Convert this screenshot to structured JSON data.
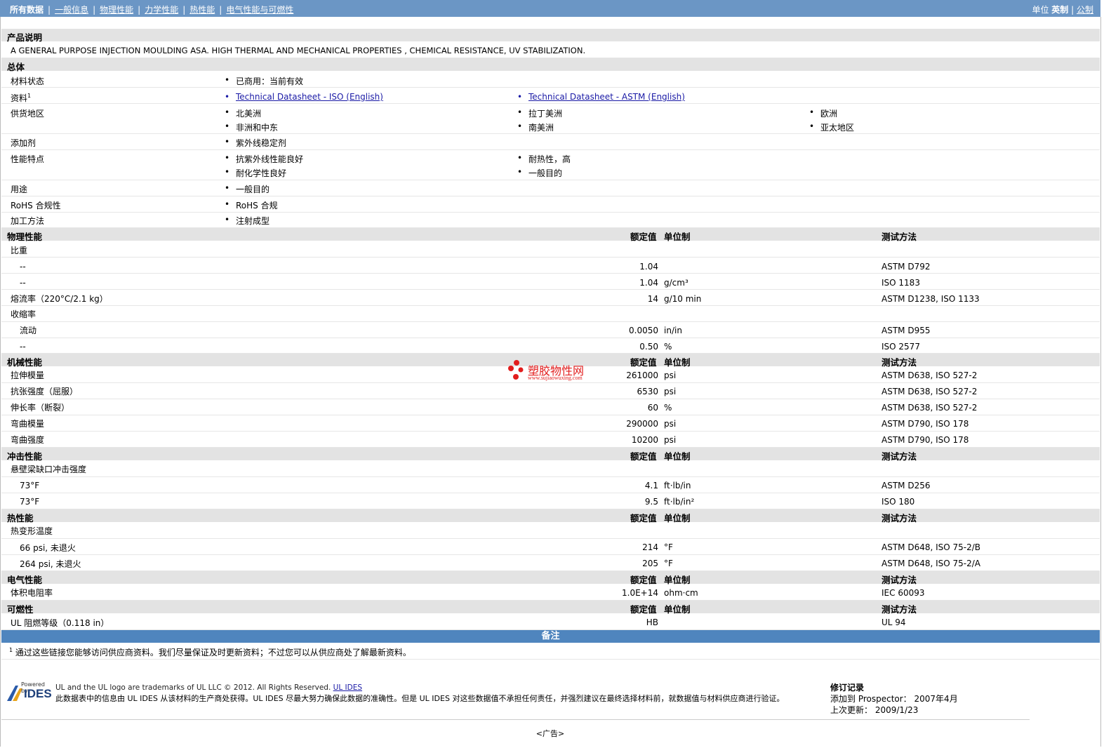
{
  "nav": {
    "items": [
      "所有数据",
      "一般信息",
      "物理性能",
      "力学性能",
      "热性能",
      "电气性能与可燃性"
    ],
    "units_label": "单位",
    "units_imperial": "英制",
    "units_metric": "公制"
  },
  "product": {
    "section_title": "产品说明",
    "description": "A GENERAL PURPOSE INJECTION MOULDING ASA. HIGH THERMAL AND MECHANICAL PROPERTIES , CHEMICAL RESISTANCE, UV STABILIZATION."
  },
  "general": {
    "section_title": "总体",
    "material_status_label": "材料状态",
    "material_status": "已商用：当前有效",
    "docs_label": "资料",
    "docs_sup": "1",
    "doc1": "Technical Datasheet - ISO (English)",
    "doc2": "Technical Datasheet - ASTM (English)",
    "regions_label": "供货地区",
    "regions": [
      "北美洲",
      "拉丁美洲",
      "欧洲",
      "非洲和中东",
      "南美洲",
      "亚太地区"
    ],
    "additives_label": "添加剂",
    "additives": "紫外线稳定剂",
    "features_label": "性能特点",
    "features": [
      "抗紫外线性能良好",
      "耐热性，高",
      "耐化学性良好",
      "一般目的"
    ],
    "uses_label": "用途",
    "uses": "一般目的",
    "rohs_label": "RoHS 合规性",
    "rohs": "RoHS 合规",
    "processing_label": "加工方法",
    "processing": "注射成型"
  },
  "headers": {
    "nominal": "额定值",
    "unit": "单位制",
    "test": "测试方法"
  },
  "physical": {
    "section_title": "物理性能",
    "rows": [
      {
        "label": "比重",
        "value": "",
        "unit": "",
        "test": "",
        "indent": false
      },
      {
        "label": "--",
        "value": "1.04",
        "unit": "",
        "test": "ASTM D792",
        "indent": true
      },
      {
        "label": "--",
        "value": "1.04",
        "unit": "g/cm³",
        "test": "ISO 1183",
        "indent": true
      },
      {
        "label": "熔流率（220°C/2.1 kg）",
        "value": "14",
        "unit": "g/10 min",
        "test": "ASTM D1238, ISO 1133",
        "indent": false
      },
      {
        "label": "收缩率",
        "value": "",
        "unit": "",
        "test": "",
        "indent": false
      },
      {
        "label": "流动",
        "value": "0.0050",
        "unit": "in/in",
        "test": "ASTM D955",
        "indent": true
      },
      {
        "label": "--",
        "value": "0.50",
        "unit": "%",
        "test": "ISO 2577",
        "indent": true
      }
    ]
  },
  "mechanical": {
    "section_title": "机械性能",
    "rows": [
      {
        "label": "拉伸模量",
        "value": "261000",
        "unit": "psi",
        "test": "ASTM D638, ISO 527-2"
      },
      {
        "label": "抗张强度（屈服）",
        "value": "6530",
        "unit": "psi",
        "test": "ASTM D638, ISO 527-2"
      },
      {
        "label": "伸长率（断裂）",
        "value": "60",
        "unit": "%",
        "test": "ASTM D638, ISO 527-2"
      },
      {
        "label": "弯曲模量",
        "value": "290000",
        "unit": "psi",
        "test": "ASTM D790, ISO 178"
      },
      {
        "label": "弯曲强度",
        "value": "10200",
        "unit": "psi",
        "test": "ASTM D790, ISO 178"
      }
    ]
  },
  "impact": {
    "section_title": "冲击性能",
    "rows": [
      {
        "label": "悬壁梁缺口冲击强度",
        "value": "",
        "unit": "",
        "test": "",
        "indent": false
      },
      {
        "label": "73°F",
        "value": "4.1",
        "unit": "ft·lb/in",
        "test": "ASTM D256",
        "indent": true
      },
      {
        "label": "73°F",
        "value": "9.5",
        "unit": "ft·lb/in²",
        "test": "ISO 180",
        "indent": true
      }
    ]
  },
  "thermal": {
    "section_title": "热性能",
    "rows": [
      {
        "label": "热变形温度",
        "value": "",
        "unit": "",
        "test": "",
        "indent": false
      },
      {
        "label": "66 psi, 未退火",
        "value": "214",
        "unit": "°F",
        "test": "ASTM D648, ISO 75-2/B",
        "indent": true
      },
      {
        "label": "264 psi, 未退火",
        "value": "205",
        "unit": "°F",
        "test": "ASTM D648, ISO 75-2/A",
        "indent": true
      }
    ]
  },
  "electrical": {
    "section_title": "电气性能",
    "rows": [
      {
        "label": "体积电阻率",
        "value": "1.0E+14",
        "unit": "ohm·cm",
        "test": "IEC 60093"
      }
    ]
  },
  "flammability": {
    "section_title": "可燃性",
    "rows": [
      {
        "label": "UL 阻燃等级（0.118 in）",
        "value": "HB",
        "unit": "",
        "test": "UL 94"
      }
    ]
  },
  "notes": {
    "title": "备注",
    "sup": "1",
    "text": "通过这些链接您能够访问供应商资料。我们尽量保证及时更新资料；不过您可以从供应商处了解最新资料。"
  },
  "footer": {
    "logo_small": "Powered by",
    "logo_big": "IDES",
    "trademark": "UL and the UL logo are trademarks of UL LLC © 2012. All Rights Reserved.",
    "ul_ides_link": "UL IDES",
    "disclaimer": "此数据表中的信息由  UL IDES 从该材料的生产商处获得。UL IDES 尽最大努力确保此数据的准确性。但是  UL IDES 对这些数据值不承担任何责任，并强烈建议在最终选择材料前，就数据值与材料供应商进行验证。",
    "revision_title": "修订记录",
    "added_label": "添加到  Prospector：",
    "added_value": "2007年4月",
    "updated_label": "上次更新：",
    "updated_value": "2009/1/23"
  },
  "watermark": {
    "name": "塑胶物性网",
    "url": "www.sujiaowuxing.com"
  },
  "ad": "<广告>",
  "colors": {
    "topbar": "#6b96c5",
    "section_bg": "#e3e3e3",
    "notes_bar": "#4f85be",
    "link": "#1a1aa6",
    "watermark": "#e21d1d"
  }
}
